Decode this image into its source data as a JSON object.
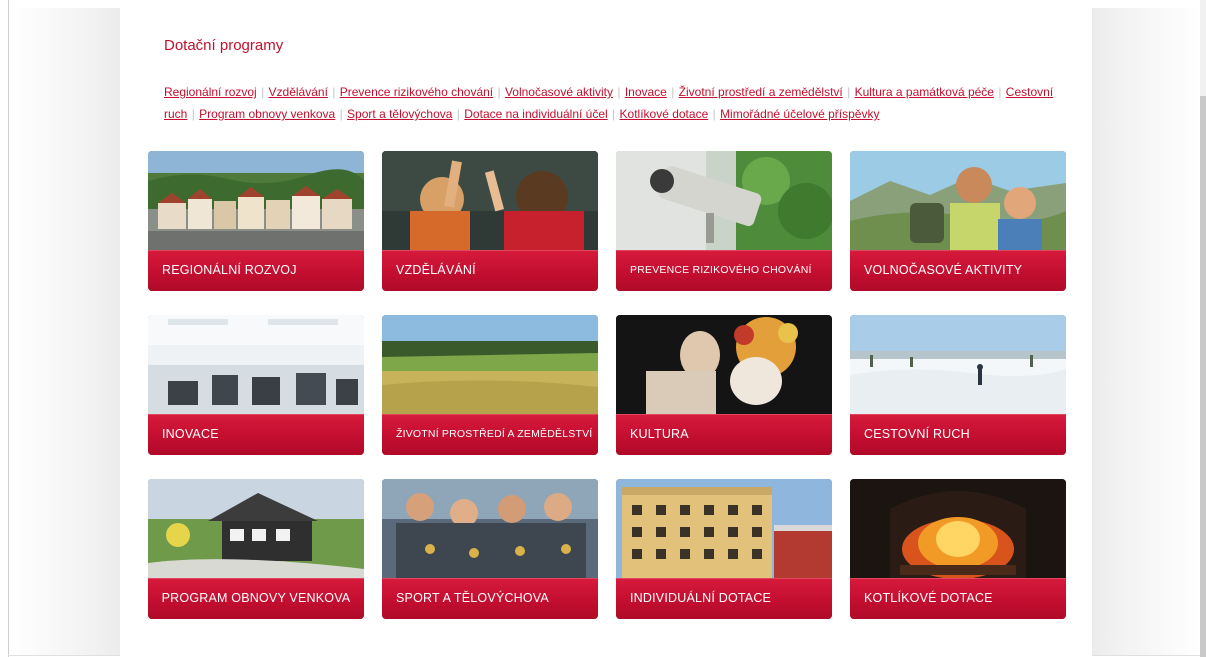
{
  "heading": "Dotační programy",
  "links": [
    "Regionální rozvoj",
    "Vzdělávání",
    "Prevence rizikového chování",
    "Volnočasové aktivity",
    "Inovace",
    "Životní prostředí a zemědělství",
    "Kultura a památková péče",
    "Cestovní ruch",
    "Program obnovy venkova",
    "Sport a tělovýchova",
    "Dotace na individuální účel",
    "Kotlíkové dotace",
    "Mimořádné účelové příspěvky"
  ],
  "link_separator": "|",
  "tiles": [
    {
      "label": "REGIONÁLNÍ ROZVOJ",
      "photo": "town-square-photo"
    },
    {
      "label": "VZDĚLÁVÁNÍ",
      "photo": "classroom-photo"
    },
    {
      "label": "PREVENCE RIZIKOVÉHO CHOVÁNÍ",
      "photo": "security-camera-photo"
    },
    {
      "label": "VOLNOČASOVÉ AKTIVITY",
      "photo": "hikers-photo"
    },
    {
      "label": "INOVACE",
      "photo": "laboratory-photo"
    },
    {
      "label": "ŽIVOTNÍ PROSTŘEDÍ A ZEMĚDĚLSTVÍ",
      "photo": "wheat-field-photo"
    },
    {
      "label": "KULTURA",
      "photo": "theatre-actors-photo"
    },
    {
      "label": "CESTOVNÍ RUCH",
      "photo": "winter-skiing-photo"
    },
    {
      "label": "PROGRAM OBNOVY VENKOVA",
      "photo": "village-house-photo"
    },
    {
      "label": "SPORT A TĚLOVÝCHOVA",
      "photo": "athletes-medals-photo"
    },
    {
      "label": "INDIVIDUÁLNÍ DOTACE",
      "photo": "historic-building-photo"
    },
    {
      "label": "KOTLÍKOVÉ DOTACE",
      "photo": "fireplace-photo"
    }
  ],
  "colors": {
    "accent": "#c2102e",
    "band_top": "#d61a3c",
    "band_bottom": "#b00a28",
    "separator": "#c4c4c4"
  }
}
